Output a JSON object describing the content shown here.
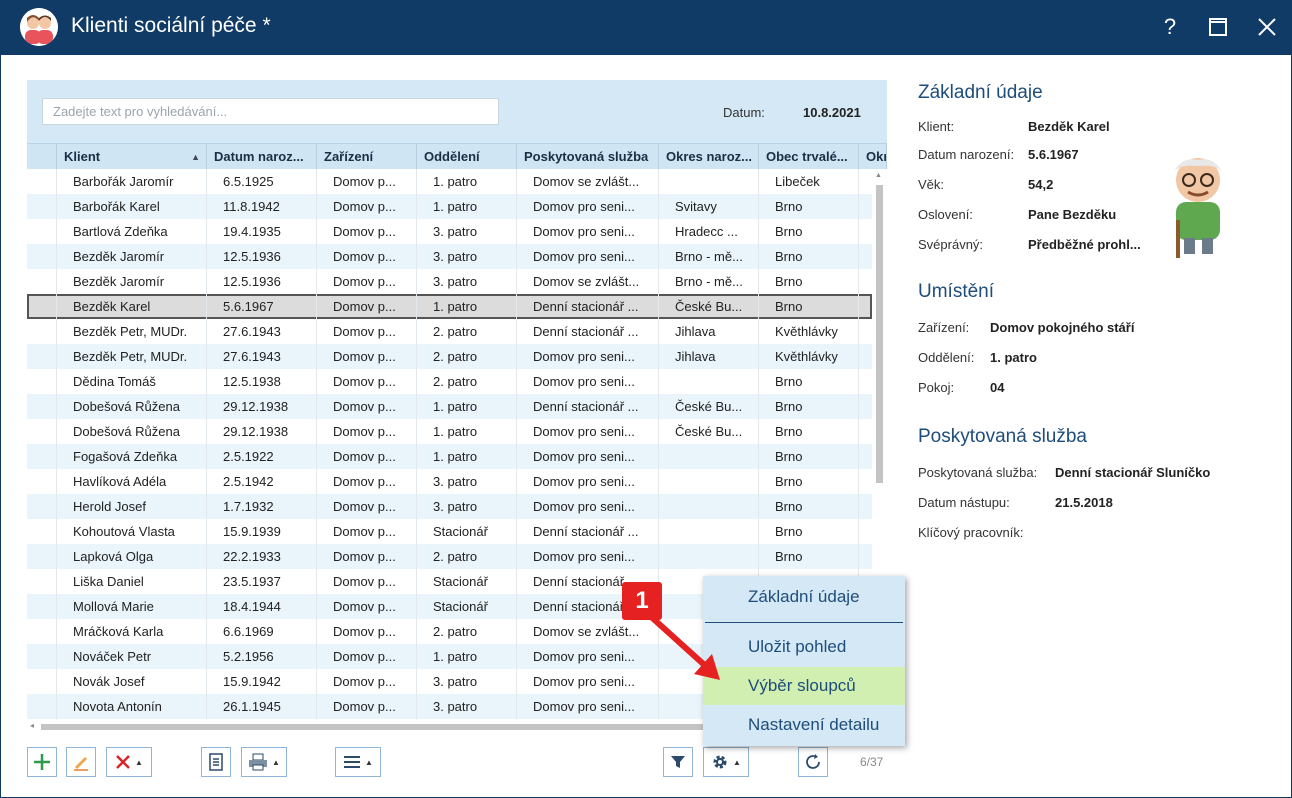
{
  "window": {
    "title": "Klienti sociální péče *",
    "help": "?",
    "maximize": "☐",
    "close": "✕"
  },
  "search": {
    "placeholder": "Zadejte text pro vyhledávání..."
  },
  "date": {
    "label": "Datum:",
    "value": "10.8.2021"
  },
  "grid": {
    "headers": [
      "Klient",
      "Datum naroz...",
      "Zařízení",
      "Oddělení",
      "Poskytovaná služba",
      "Okres naroz...",
      "Obec trvalé...",
      "Okr"
    ],
    "rows": [
      [
        "Barbořák Jaromír",
        "6.5.1925",
        "Domov p...",
        "1. patro",
        "Domov se zvlášt...",
        "",
        "Libeček"
      ],
      [
        "Barbořák Karel",
        "11.8.1942",
        "Domov p...",
        "1. patro",
        "Domov pro seni...",
        "Svitavy",
        "Brno"
      ],
      [
        "Bartlová Zdeňka",
        "19.4.1935",
        "Domov p...",
        "3. patro",
        "Domov pro seni...",
        "Hradecc ...",
        "Brno"
      ],
      [
        "Bezděk Jaromír",
        "12.5.1936",
        "Domov p...",
        "3. patro",
        "Domov pro seni...",
        "Brno - mě...",
        "Brno"
      ],
      [
        "Bezděk Jaromír",
        "12.5.1936",
        "Domov p...",
        "3. patro",
        "Domov se zvlášt...",
        "Brno - mě...",
        "Brno"
      ],
      [
        "Bezděk Karel",
        "5.6.1967",
        "Domov p...",
        "1. patro",
        "Denní stacionář ...",
        "České Bu...",
        "Brno"
      ],
      [
        "Bezděk Petr, MUDr.",
        "27.6.1943",
        "Domov p...",
        "2. patro",
        "Denní stacionář ...",
        "Jihlava",
        "Květhlávky"
      ],
      [
        "Bezděk Petr, MUDr.",
        "27.6.1943",
        "Domov p...",
        "2. patro",
        "Domov pro seni...",
        "Jihlava",
        "Květhlávky"
      ],
      [
        "Dědina Tomáš",
        "12.5.1938",
        "Domov p...",
        "2. patro",
        "Domov pro seni...",
        "",
        "Brno"
      ],
      [
        "Dobešová Růžena",
        "29.12.1938",
        "Domov p...",
        "1. patro",
        "Denní stacionář ...",
        "České Bu...",
        "Brno"
      ],
      [
        "Dobešová Růžena",
        "29.12.1938",
        "Domov p...",
        "1. patro",
        "Domov pro seni...",
        "České Bu...",
        "Brno"
      ],
      [
        "Fogašová Zdeňka",
        "2.5.1922",
        "Domov p...",
        "1. patro",
        "Domov pro seni...",
        "",
        "Brno"
      ],
      [
        "Havlíková Adéla",
        "2.5.1942",
        "Domov p...",
        "3. patro",
        "Domov pro seni...",
        "",
        "Brno"
      ],
      [
        "Herold Josef",
        "1.7.1932",
        "Domov p...",
        "3. patro",
        "Domov pro seni...",
        "",
        "Brno"
      ],
      [
        "Kohoutová Vlasta",
        "15.9.1939",
        "Domov p...",
        "Stacionář",
        "Denní stacionář ...",
        "",
        "Brno"
      ],
      [
        "Lapková Olga",
        "22.2.1933",
        "Domov p...",
        "2. patro",
        "Domov pro seni...",
        "",
        "Brno"
      ],
      [
        "Liška Daniel",
        "23.5.1937",
        "Domov p...",
        "Stacionář",
        "Denní stacionář ...",
        "",
        ""
      ],
      [
        "Mollová Marie",
        "18.4.1944",
        "Domov p...",
        "Stacionář",
        "Denní stacionář ...",
        "",
        ""
      ],
      [
        "Mráčková Karla",
        "6.6.1969",
        "Domov p...",
        "2. patro",
        "Domov se zvlášt...",
        "",
        ""
      ],
      [
        "Nováček Petr",
        "5.2.1956",
        "Domov p...",
        "1. patro",
        "Domov pro seni...",
        "",
        ""
      ],
      [
        "Novák Josef",
        "15.9.1942",
        "Domov p...",
        "3. patro",
        "Domov pro seni...",
        "",
        ""
      ],
      [
        "Novota Antonín",
        "26.1.1945",
        "Domov p...",
        "3. patro",
        "Domov pro seni...",
        "",
        ""
      ]
    ],
    "selected_row": 5,
    "count": "6/37"
  },
  "menu": {
    "items": [
      "Základní údaje",
      "Uložit pohled",
      "Výběr sloupců",
      "Nastavení detailu"
    ],
    "highlighted": 2
  },
  "callout": {
    "number": "1",
    "color": "#e52121"
  },
  "detail": {
    "basic": {
      "title": "Základní údaje",
      "fields": [
        {
          "label": "Klient:",
          "value": "Bezděk Karel"
        },
        {
          "label": "Datum narození:",
          "value": "5.6.1967"
        },
        {
          "label": "Věk:",
          "value": "54,2"
        },
        {
          "label": "Oslovení:",
          "value": "Pane Bezděku"
        },
        {
          "label": "Svéprávný:",
          "value": "Předběžné prohl..."
        }
      ]
    },
    "placement": {
      "title": "Umístění",
      "fields": [
        {
          "label": "Zařízení:",
          "value": "Domov pokojného stáří"
        },
        {
          "label": "Oddělení:",
          "value": "1. patro"
        },
        {
          "label": "Pokoj:",
          "value": "04"
        }
      ]
    },
    "service": {
      "title": "Poskytovaná služba",
      "fields": [
        {
          "label": "Poskytovaná služba:",
          "value": "Denní stacionář Sluníčko"
        },
        {
          "label": "Datum nástupu:",
          "value": "21.5.2018"
        },
        {
          "label": "Klíčový pracovník:",
          "value": ""
        }
      ]
    }
  },
  "colors": {
    "titlebar": "#0f3b66",
    "grid_header": "#cfe5f4",
    "accent": "#1e4d7b",
    "menu_highlight": "#d1efb0"
  }
}
